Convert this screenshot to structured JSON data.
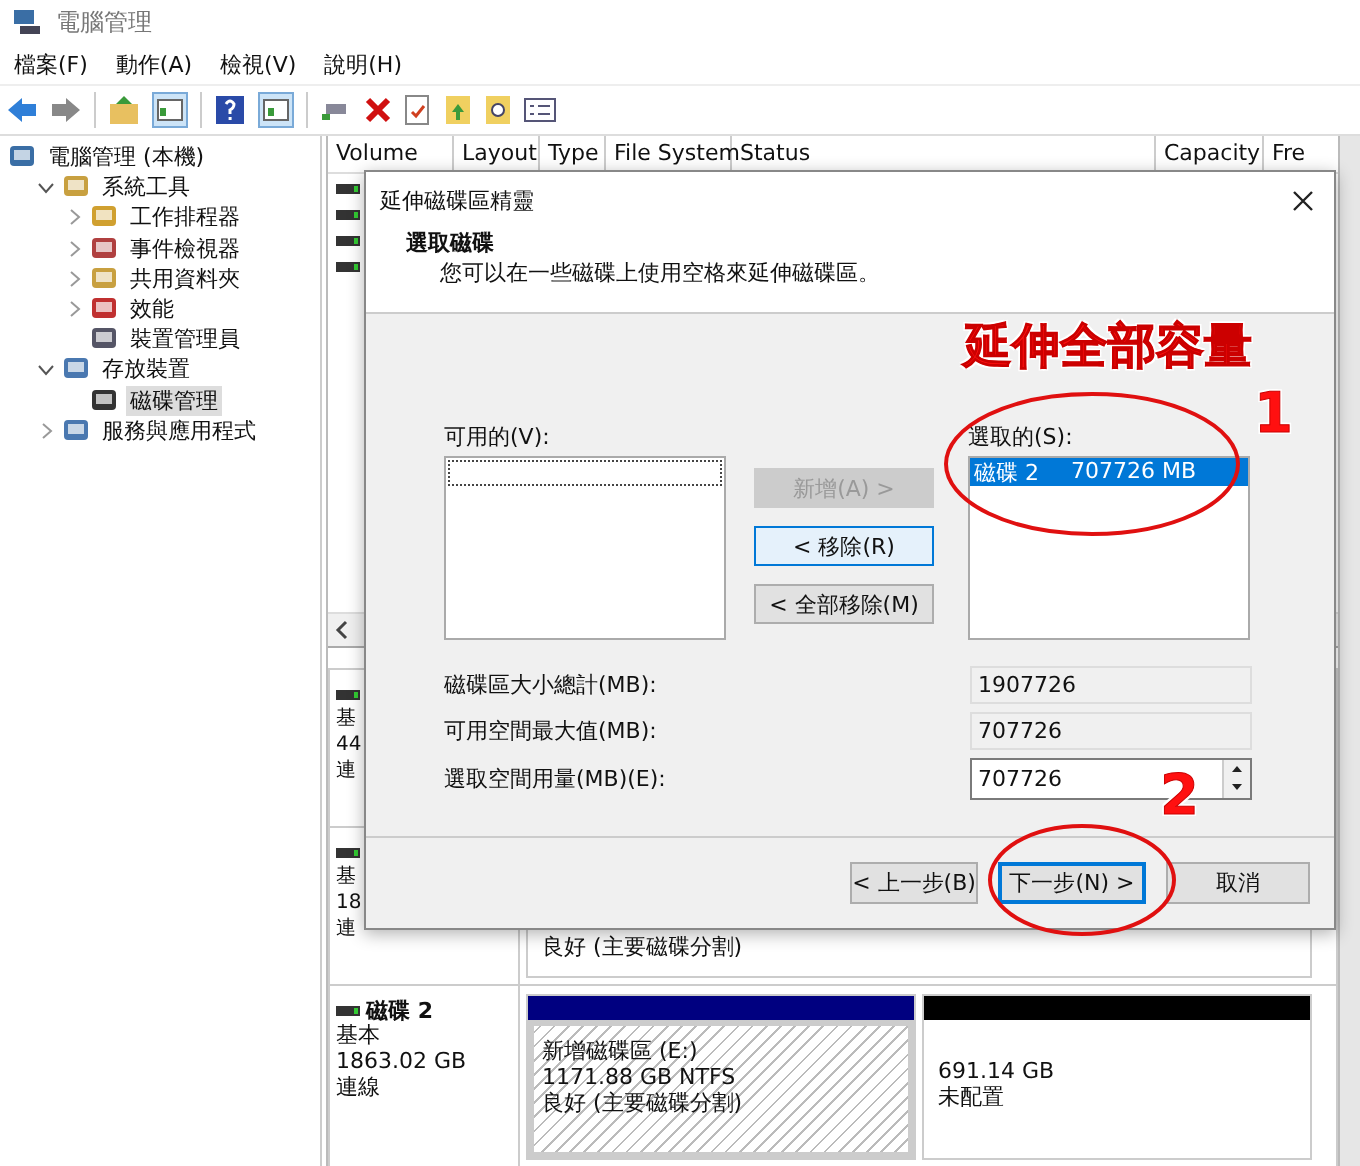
{
  "window": {
    "title": "電腦管理"
  },
  "menu": [
    "檔案(F)",
    "動作(A)",
    "檢視(V)",
    "說明(H)"
  ],
  "tree": [
    {
      "label": "電腦管理 (本機)",
      "selected": false,
      "children": [
        {
          "label": "系統工具",
          "expanded": true,
          "selected": false,
          "children": [
            {
              "label": "工作排程器",
              "expanded": false,
              "selected": false
            },
            {
              "label": "事件檢視器",
              "expanded": false,
              "selected": false
            },
            {
              "label": "共用資料夾",
              "expanded": false,
              "selected": false
            },
            {
              "label": "效能",
              "expanded": false,
              "selected": false
            },
            {
              "label": "裝置管理員",
              "selected": false
            }
          ]
        },
        {
          "label": "存放裝置",
          "expanded": true,
          "selected": false,
          "children": [
            {
              "label": "磁碟管理",
              "selected": true
            }
          ]
        },
        {
          "label": "服務與應用程式",
          "expanded": false,
          "selected": false
        }
      ]
    }
  ],
  "volume_table": {
    "columns": [
      "Volume",
      "Layout",
      "Type",
      "File System",
      "Status",
      "Capacity",
      "Fre"
    ]
  },
  "disks": [
    {
      "kind": "covered",
      "lines": [
        "基",
        "44",
        "連"
      ]
    },
    {
      "kind": "covered",
      "lines": [
        "基",
        "18",
        "連"
      ],
      "partitions": [
        {
          "kind": "primary",
          "lines": [
            "良好 (主要磁碟分割)"
          ]
        }
      ]
    },
    {
      "kind": "full",
      "name": "磁碟 2",
      "lines": [
        "基本",
        "1863.02 GB",
        "連線"
      ],
      "partitions": [
        {
          "kind": "primary",
          "label": "新增磁碟區  (E:)",
          "lines": [
            "1171.88 GB NTFS",
            "良好 (主要磁碟分割)"
          ]
        },
        {
          "kind": "unallocated",
          "lines": [
            "691.14 GB",
            "未配置"
          ]
        }
      ]
    }
  ],
  "dialog": {
    "title": "延伸磁碟區精靈",
    "heading": "選取磁碟",
    "subtitle": "您可以在一些磁碟上使用空格來延伸磁碟區。",
    "available_label": "可用的(V):",
    "selected_label": "選取的(S):",
    "selected_items": [
      {
        "name": "磁碟 2",
        "size": "707726 MB",
        "selected": true
      }
    ],
    "move_buttons": [
      {
        "label": "新增(A) >",
        "disabled": true,
        "focused": false
      },
      {
        "label": "< 移除(R)",
        "disabled": false,
        "focused": true
      },
      {
        "label": "< 全部移除(M)",
        "disabled": false,
        "focused": false
      }
    ],
    "fields": [
      {
        "kind": "readonly",
        "label": "磁碟區大小總計(MB):",
        "value": "1907726"
      },
      {
        "kind": "readonly",
        "label": "可用空間最大值(MB):",
        "value": "707726"
      },
      {
        "kind": "spin",
        "label": "選取空間用量(MB)(E):",
        "value": "707726"
      }
    ],
    "footer_buttons": [
      {
        "label": "< 上一步(B)",
        "default": false
      },
      {
        "label": "下一步(N) >",
        "default": true
      },
      {
        "label": "取消",
        "default": false
      }
    ]
  },
  "annotations": {
    "caption": "延伸全部容量",
    "marks": [
      "1",
      "2"
    ]
  }
}
